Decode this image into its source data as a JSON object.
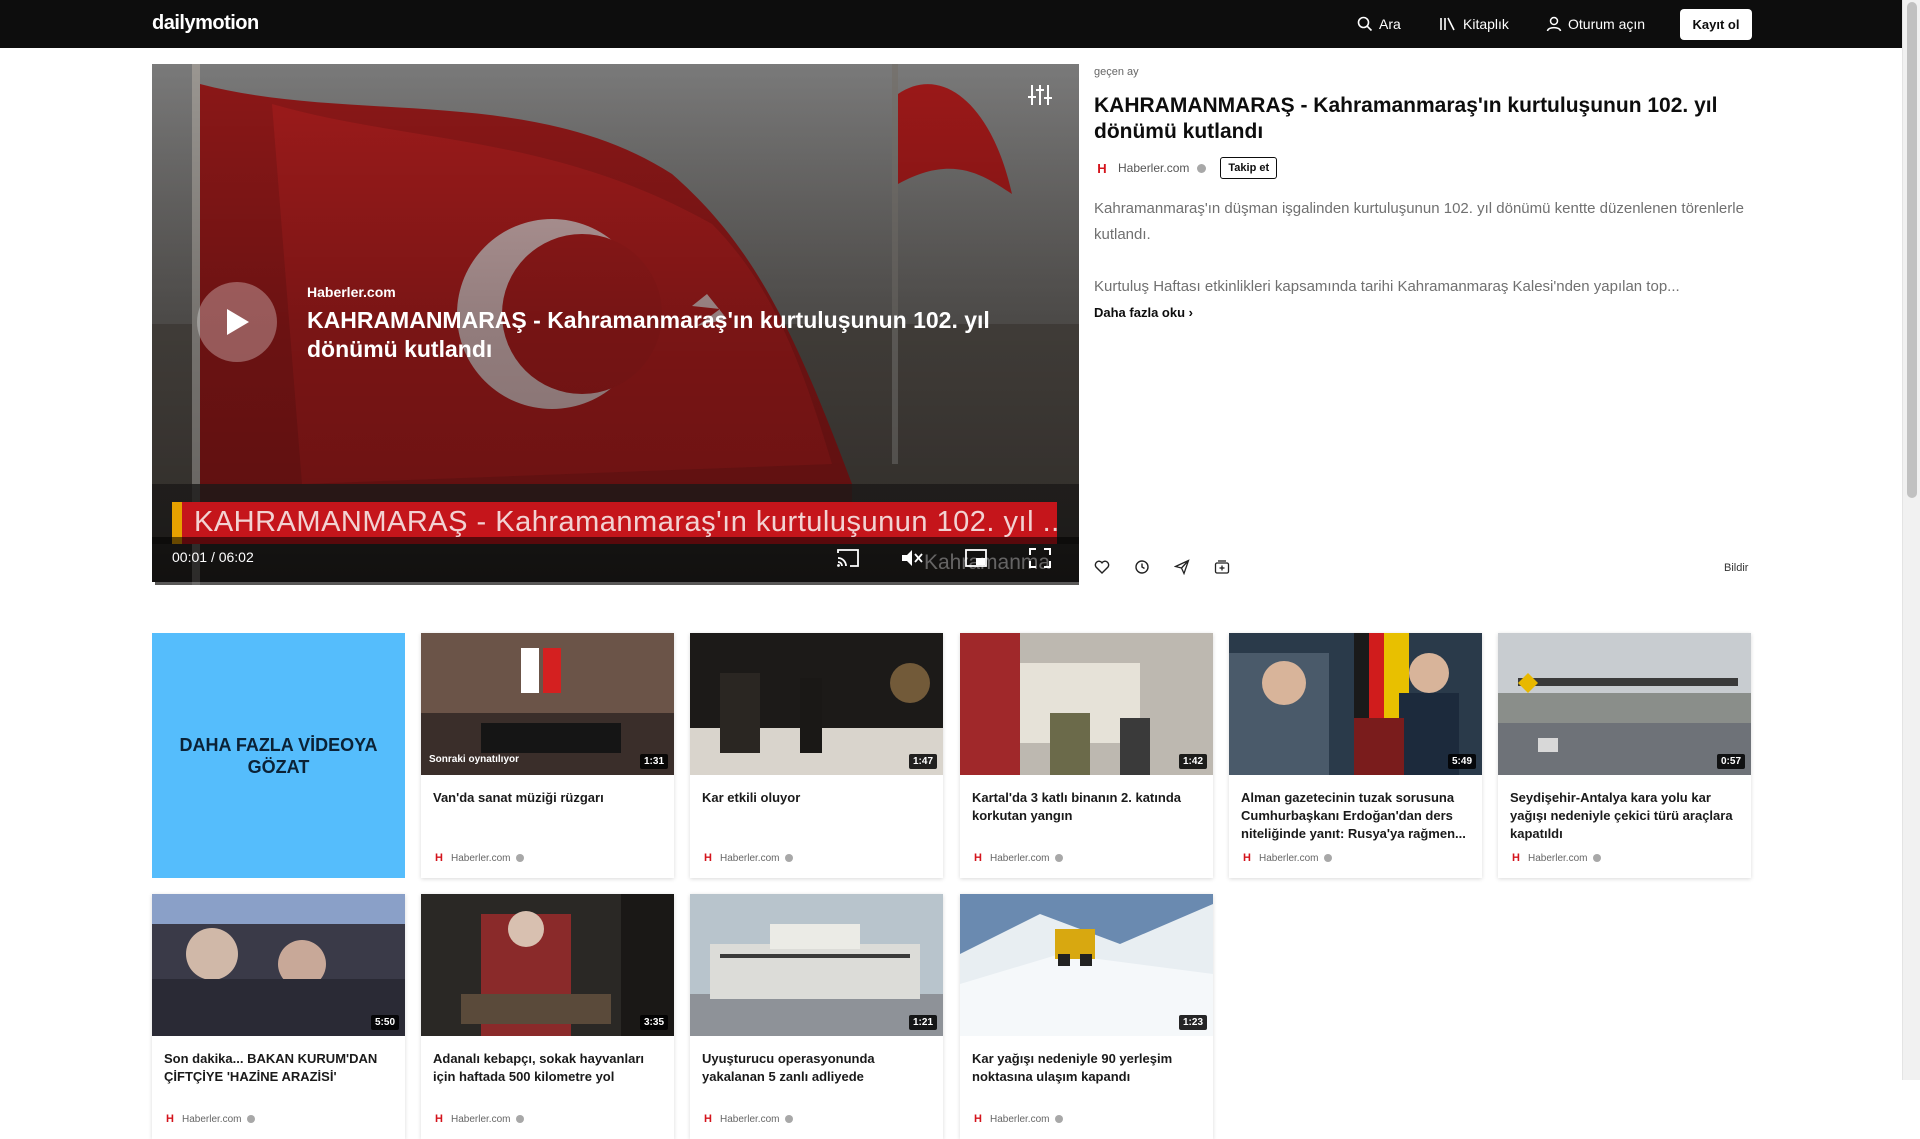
{
  "header": {
    "logo": "dailymotion",
    "search_label": "Ara",
    "library_label": "Kitaplık",
    "login_label": "Oturum açın",
    "signup_label": "Kayıt ol"
  },
  "player": {
    "overlay_channel": "Haberler.com",
    "overlay_title": "KAHRAMANMARAŞ - Kahramanmaraş'ın kurtuluşunun 102. yıl dönümü kutlandı",
    "ticker_text": "KAHRAMANMARAŞ - Kahramanmaraş'ın kurtuluşunun 102. yıl ...",
    "watermark": "Kahramanma",
    "current_time": "00:01",
    "time_separator": "/",
    "duration": "06:02",
    "progress": 0.003
  },
  "video": {
    "posted": "geçen ay",
    "title": "KAHRAMANMARAŞ - Kahramanmaraş'ın kurtuluşunun 102. yıl dönümü kutlandı",
    "channel": "Haberler.com",
    "channel_logo_letter": "H",
    "follow_label": "Takip et",
    "description_1": "Kahramanmaraş'ın düşman işgalinden kurtuluşunun 102. yıl dönümü kentte düzenlenen törenlerle kutlandı.",
    "description_2": "Kurtuluş Haftası etkinlikleri kapsamında tarihi Kahramanmaraş Kalesi'nden yapılan top...",
    "read_more": "Daha fazla oku",
    "report": "Bildir"
  },
  "promo": {
    "label": "DAHA FAZLA VİDEOYA GÖZAT"
  },
  "next_label": "Sonraki oynatılıyor",
  "cards": [
    {
      "title": "Van'da sanat müziği rüzgarı",
      "duration": "1:31",
      "channel": "Haberler.com"
    },
    {
      "title": "Kar etkili oluyor",
      "duration": "1:47",
      "channel": "Haberler.com"
    },
    {
      "title": "Kartal'da 3 katlı binanın 2. katında korkutan yangın",
      "duration": "1:42",
      "channel": "Haberler.com"
    },
    {
      "title": "Alman gazetecinin tuzak sorusuna Cumhurbaşkanı Erdoğan'dan ders niteliğinde yanıt: Rusya'ya rağmen...",
      "duration": "5:49",
      "channel": "Haberler.com"
    },
    {
      "title": "Seydişehir-Antalya kara yolu kar yağışı nedeniyle çekici türü araçlara kapatıldı",
      "duration": "0:57",
      "channel": "Haberler.com"
    },
    {
      "title": "Son dakika... BAKAN KURUM'DAN ÇİFTÇİYE 'HAZİNE ARAZİSİ'",
      "duration": "5:50",
      "channel": "Haberler.com"
    },
    {
      "title": "Adanalı kebapçı, sokak hayvanları için haftada 500 kilometre yol",
      "duration": "3:35",
      "channel": "Haberler.com"
    },
    {
      "title": "Uyuşturucu operasyonunda yakalanan 5 zanlı adliyede",
      "duration": "1:21",
      "channel": "Haberler.com"
    },
    {
      "title": "Kar yağışı nedeniyle 90 yerleşim noktasına ulaşım kapandı",
      "duration": "1:23",
      "channel": "Haberler.com"
    }
  ],
  "colors": {
    "header_bg": "#0d0d0d",
    "promo_bg": "#55bdfc",
    "channel_red": "#d4141c"
  }
}
